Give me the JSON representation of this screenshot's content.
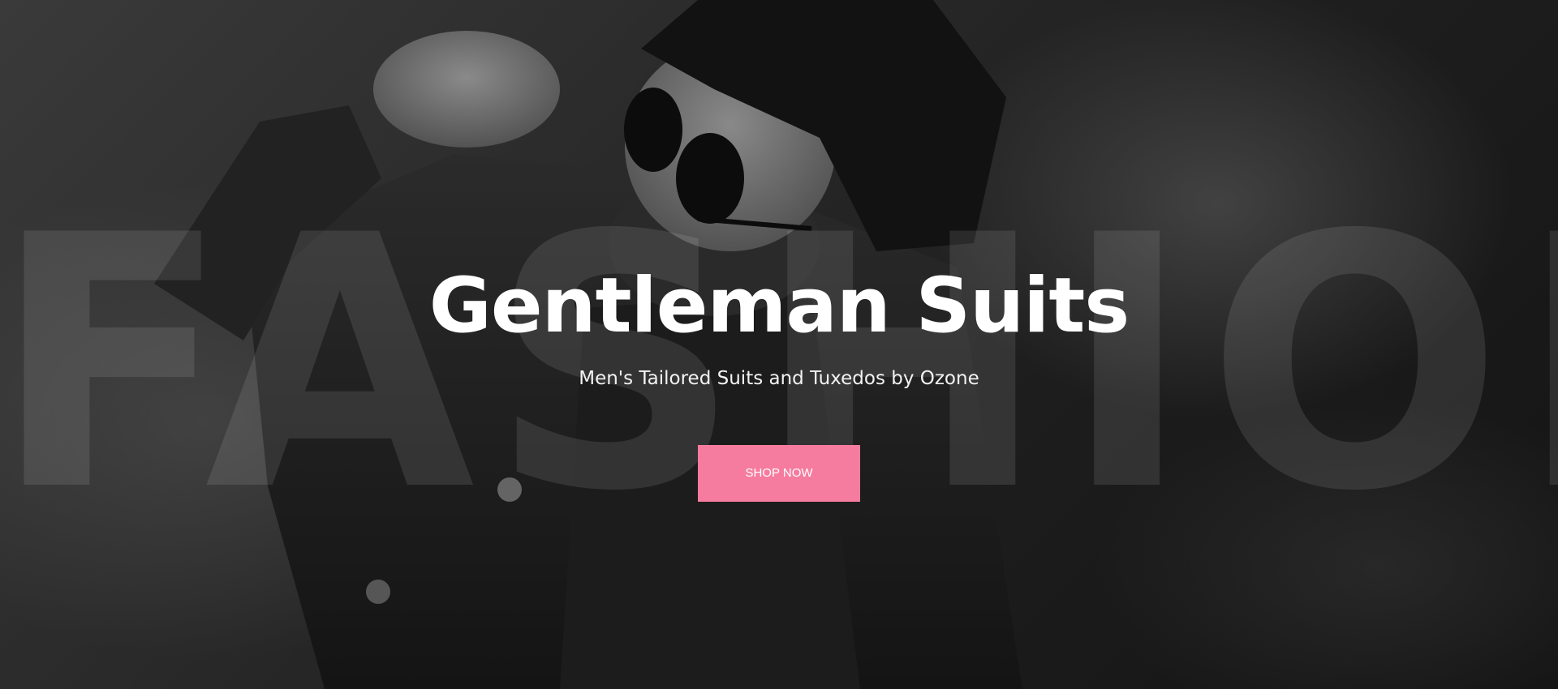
{
  "hero": {
    "background_word": "FASHION",
    "headline": "Gentleman Suits",
    "subtitle": "Men's Tailored Suits and Tuxedos by Ozone",
    "cta_label": "SHOP NOW"
  },
  "colors": {
    "accent": "#f57c9f",
    "text": "#ffffff",
    "background": "#1e1e1e"
  }
}
